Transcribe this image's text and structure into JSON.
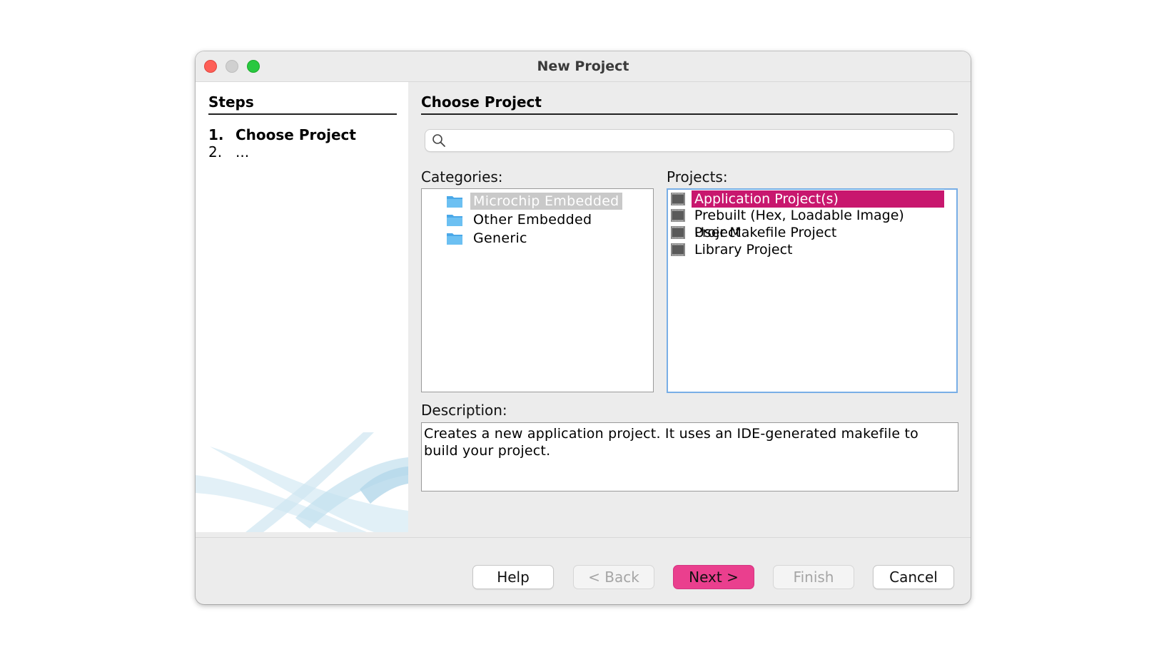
{
  "window": {
    "title": "New Project"
  },
  "steps": {
    "heading": "Steps",
    "items": [
      {
        "number": "1.",
        "label": "Choose Project"
      },
      {
        "number": "2.",
        "label": "..."
      }
    ]
  },
  "main": {
    "heading": "Choose Project",
    "search": {
      "value": "",
      "placeholder": ""
    },
    "categories_label": "Categories:",
    "categories": [
      {
        "label": "Microchip Embedded",
        "selected": true
      },
      {
        "label": "Other Embedded",
        "selected": false
      },
      {
        "label": "Generic",
        "selected": false
      }
    ],
    "projects_label": "Projects:",
    "projects": [
      {
        "label": "Application Project(s)",
        "selected": true
      },
      {
        "label": "Prebuilt (Hex, Loadable Image) Project",
        "selected": false
      },
      {
        "label": "User Makefile Project",
        "selected": false
      },
      {
        "label": "Library Project",
        "selected": false
      }
    ],
    "description_label": "Description:",
    "description": "Creates a new application project. It uses an IDE-generated makefile to build your project."
  },
  "buttons": {
    "help": "Help",
    "back": "< Back",
    "next": "Next >",
    "finish": "Finish",
    "cancel": "Cancel"
  },
  "colors": {
    "selection": "#c8176e",
    "primary_button": "#ea3f8e",
    "focus_border": "#78aee6",
    "folder": "#4aa8e8"
  },
  "icons": {
    "search": "search-icon",
    "category": "folder-icon",
    "project": "chip-icon"
  }
}
